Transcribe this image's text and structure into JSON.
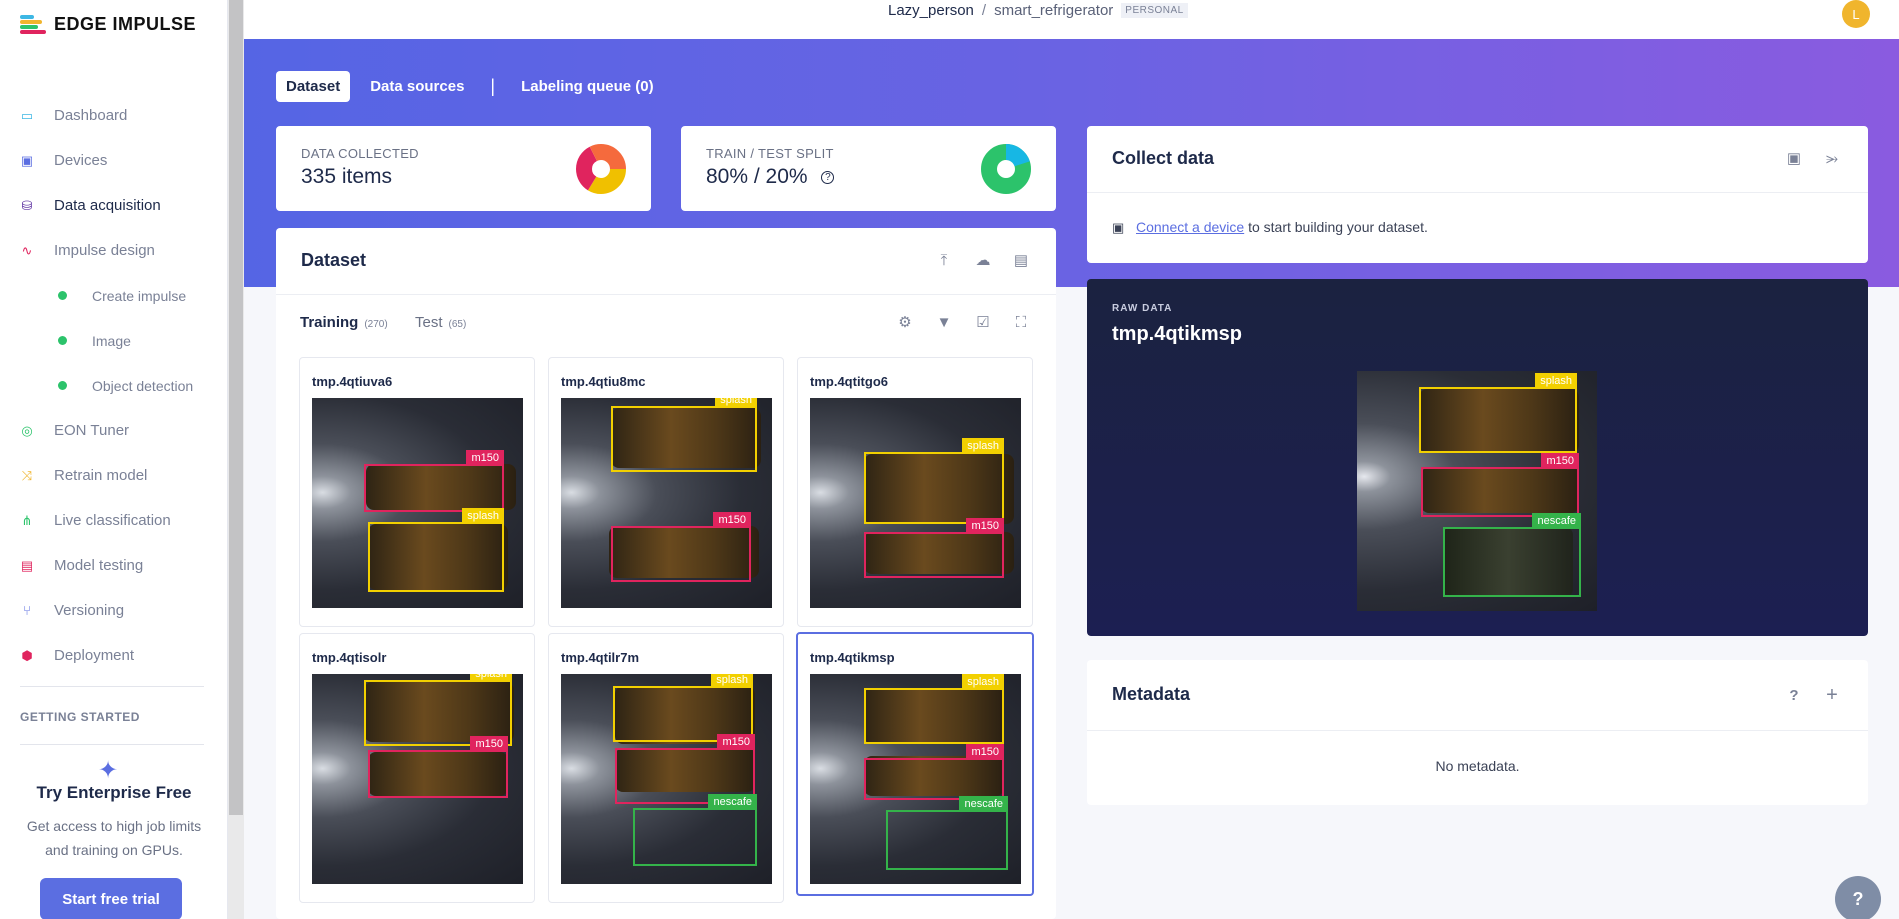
{
  "brand": {
    "name": "EDGE IMPULSE"
  },
  "sidebar": {
    "items": [
      {
        "label": "Dashboard",
        "icon": "monitor-icon",
        "color": "#3db7e4"
      },
      {
        "label": "Devices",
        "icon": "chip-icon",
        "color": "#5b6ee1"
      },
      {
        "label": "Data acquisition",
        "icon": "database-icon",
        "color": "#5a2ca0"
      },
      {
        "label": "Impulse design",
        "icon": "pulse-icon",
        "color": "#e0245e"
      }
    ],
    "subitems": [
      "Create impulse",
      "Image",
      "Object detection"
    ],
    "items2": [
      {
        "label": "EON Tuner",
        "icon": "compass-icon",
        "color": "#2cc36b"
      },
      {
        "label": "Retrain model",
        "icon": "shuffle-icon",
        "color": "#f0b52d"
      },
      {
        "label": "Live classification",
        "icon": "branch-icon",
        "color": "#2cc36b"
      },
      {
        "label": "Model testing",
        "icon": "clipboard-icon",
        "color": "#e0245e"
      },
      {
        "label": "Versioning",
        "icon": "git-icon",
        "color": "#5b6ee1"
      },
      {
        "label": "Deployment",
        "icon": "box-icon",
        "color": "#e0245e"
      }
    ],
    "getting_started": "GETTING STARTED",
    "enterprise_title": "Try Enterprise Free",
    "enterprise_desc": "Get access to high job limits and training on GPUs.",
    "trial_button": "Start free trial"
  },
  "header": {
    "user": "Lazy_person",
    "separator": "/",
    "project": "smart_refrigerator",
    "badge": "PERSONAL",
    "avatar": "L"
  },
  "tabs": {
    "dataset": "Dataset",
    "sources": "Data sources",
    "divider": "|",
    "queue": "Labeling queue (0)"
  },
  "stats": {
    "collected_label": "DATA COLLECTED",
    "collected_value": "335 items",
    "split_label": "TRAIN / TEST SPLIT",
    "split_value": "80% / 20%",
    "split_train_fraction": 0.8,
    "help": "?"
  },
  "dataset": {
    "title": "Dataset",
    "training_label": "Training",
    "training_count": "(270)",
    "test_label": "Test",
    "test_count": "(65)",
    "samples": [
      {
        "name": "tmp.4qtiuva6",
        "labels": [
          "m150",
          "splash"
        ]
      },
      {
        "name": "tmp.4qtiu8mc",
        "labels": [
          "splash",
          "m150"
        ]
      },
      {
        "name": "tmp.4qtitgo6",
        "labels": [
          "splash",
          "m150"
        ]
      },
      {
        "name": "tmp.4qtisolr",
        "labels": [
          "splash",
          "m150"
        ]
      },
      {
        "name": "tmp.4qtilr7m",
        "labels": [
          "splash",
          "m150",
          "nescafe"
        ]
      },
      {
        "name": "tmp.4qtikmsp",
        "labels": [
          "splash",
          "m150",
          "nescafe"
        ]
      }
    ]
  },
  "collect": {
    "title": "Collect data",
    "link": "Connect a device",
    "text": " to start building your dataset."
  },
  "raw": {
    "label": "RAW DATA",
    "title": "tmp.4qtikmsp",
    "labels": [
      "splash",
      "m150",
      "nescafe"
    ]
  },
  "metadata": {
    "title": "Metadata",
    "empty": "No metadata.",
    "help": "?",
    "add": "+"
  },
  "help_fab": "?",
  "colors": {
    "accent": "#5b6ee1",
    "splash": "#f2d000",
    "m150": "#e0245e",
    "nescafe": "#34b34a"
  }
}
